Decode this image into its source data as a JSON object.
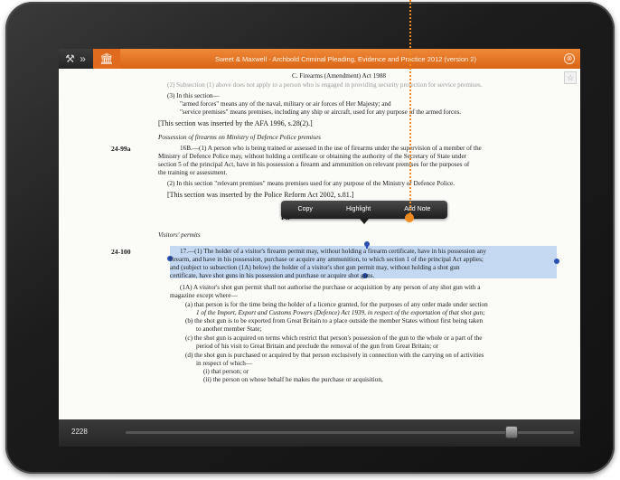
{
  "app": {
    "title": "Sweet & Maxwell - Archbold Criminal Pleading, Evidence and Practice 2012 (version 2)",
    "tools_icon": "wrench-hammer-icon",
    "home_icon": "building-icon",
    "close_icon": "close-circle-icon",
    "close_glyph": "⊗",
    "tools_glyph": "⚒ »",
    "home_glyph": "🏛",
    "bookmark_glyph": "☆"
  },
  "document": {
    "running_head": "C. Firearms (Amendment) Act 1988",
    "line_faint": "(2) Subsection (1) above does not apply to a person who is engaged in providing security protection for service premises.",
    "s3_intro": "(3) In this section—",
    "s3_armed": "\"armed forces\" means any of the naval, military or air forces of Her Majesty; and",
    "s3_service": "\"service premises\" means premises, including any ship or aircraft, used for any purpose of the armed forces.",
    "afa_note": "[This section was inserted by the AFA 1996, s.28(2).]",
    "heading_mod": "Possession of firearms on Ministry of Defence Police premises",
    "margin_a": "24-99a",
    "s16b_1": "16B.—(1) A person who is being trained or assessed in the use of firearms under the supervision of a member of the",
    "s16b_2": "Ministry of Defence Police may, without holding a certificate or obtaining the authority of the Secretary of State under",
    "s16b_3": "section 5 of the principal Act, have in his possession a firearm and ammunition on relevant premises for the purposes of",
    "s16b_4": "the training or assessment.",
    "s16b_5": "(2) In this section \"relevant premises\" means premises used for any purpose of the Ministry of Defence Police.",
    "prra_note": "[This section was inserted by the Police Reform Act 2002, s.81.]",
    "partial_heading": "Fir",
    "heading_visitors": "Visitors' permits",
    "margin_b": "24-100",
    "s17_1": "17.—(1) The holder of a visitor's firearm permit may, without holding a firearm certificate, have in his possession any",
    "s17_2": "firearm, and have in his possession, purchase or acquire any ammunition, to which section 1 of the principal Act applies;",
    "s17_3": "and (subject to subsection (1A) below) the holder of a visitor's shot gun permit may, without holding a shot gun",
    "s17_4": "certificate, have shot guns in his possession and purchase or acquire shot guns.",
    "s17_1a_1": "(1A) A visitor's shot gun permit shall not authorise the purchase or acquisition by any person of any shot gun with a",
    "s17_1a_2": "magazine except where—",
    "a_1": "(a) that person is for the time being the holder of a licence granted, for the purposes of any order made under section",
    "a_2": "1 of the Import, Export and Customs Powers (Defence) Act 1939, in respect of the exportation of that shot gun;",
    "b_1": "(b) the shot gun is to be exported from Great Britain to a place outside the member States without first being taken",
    "b_2": "to another member State;",
    "c_1": "(c) the shot gun is acquired on terms which restrict that person's possession of the gun to the whole or a part of the",
    "c_2": "period of his visit to Great Britain and preclude the removal of the gun from Great Britain; or",
    "d_1": "(d) the shot gun is purchased or acquired by that person exclusively in connection with the carrying on of activities",
    "d_2": "in respect of which—",
    "i": "(i)   that person; or",
    "ii": "(ii)  the person on whose behalf he makes the purchase or acquisition,"
  },
  "context_menu": {
    "copy": "Copy",
    "highlight": "Highlight",
    "add_note": "Add Note"
  },
  "footer": {
    "page_number": "2228",
    "slider_position": 0.86
  },
  "colors": {
    "accent_orange": "#e06a1e",
    "selection_blue": "#78aae6",
    "handle_blue": "#2a4fb0"
  }
}
